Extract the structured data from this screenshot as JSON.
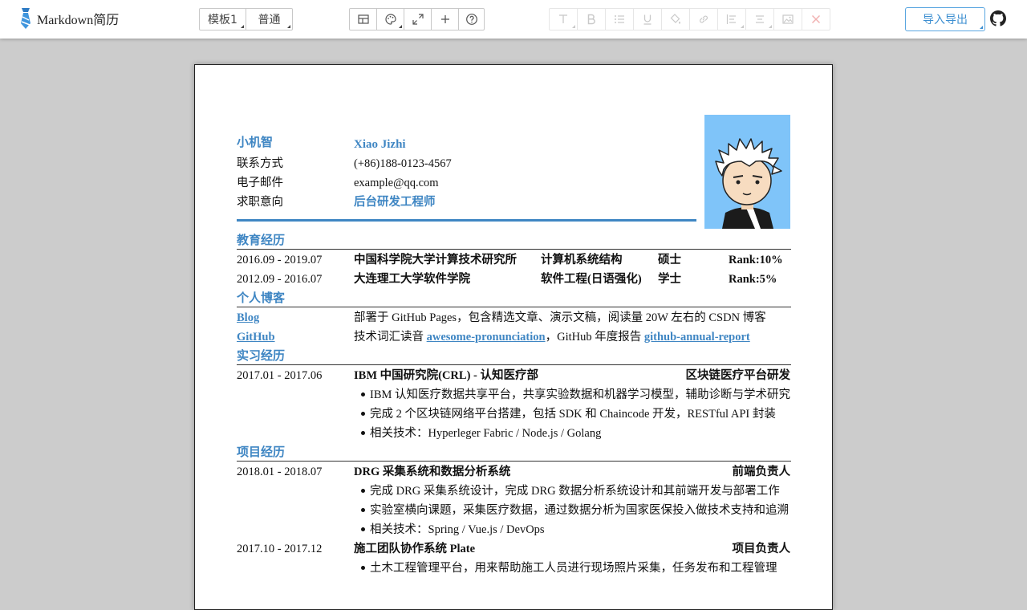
{
  "app": {
    "title": "Markdown简历",
    "template_label": "模板1",
    "style_label": "普通",
    "import_export_label": "导入导出"
  },
  "icons": {
    "logo": "tie-icon",
    "view": [
      "layout-icon",
      "palette-icon",
      "expand-icon",
      "plus-icon",
      "help-icon"
    ],
    "format": [
      "text-icon",
      "bold-icon",
      "list-icon",
      "underline-icon",
      "fill-color-icon",
      "link-icon",
      "align-left-icon",
      "align-center-icon",
      "image-icon",
      "close-icon"
    ],
    "github": "github-icon"
  },
  "colors": {
    "accent": "#3f86c3",
    "avatar_bg": "#7fc4f9"
  },
  "resume": {
    "name_cn": "小机智",
    "name_en": "Xiao Jizhi",
    "contact": [
      {
        "label": "联系方式",
        "value": "(+86)188-0123-4567"
      },
      {
        "label": "电子邮件",
        "value": "example@qq.com"
      },
      {
        "label": "求职意向",
        "value": "后台研发工程师"
      }
    ],
    "education": {
      "title": "教育经历",
      "rows": [
        {
          "period": "2016.09 - 2019.07",
          "school": "中国科学院大学计算技术研究所",
          "major": "计算机系统结构",
          "degree": "硕士",
          "rank": "Rank:10%"
        },
        {
          "period": "2012.09 - 2016.07",
          "school": "大连理工大学软件学院",
          "major": "软件工程(日语强化)",
          "degree": "学士",
          "rank": "Rank:5%"
        }
      ]
    },
    "blog": {
      "title": "个人博客",
      "blog_label": "Blog",
      "blog_desc": "部署于 GitHub Pages，包含精选文章、演示文稿，阅读量 20W 左右的 CSDN 博客",
      "github_label": "GitHub",
      "github_prefix": "技术词汇读音 ",
      "github_link1": "awesome-pronunciation",
      "github_mid": "，GitHub 年度报告 ",
      "github_link2": "github-annual-report"
    },
    "internship": {
      "title": "实习经历",
      "period": "2017.01 - 2017.06",
      "org": "IBM 中国研究院(CRL) - 认知医疗部",
      "role": "区块链医疗平台研发",
      "bullets": [
        "IBM 认知医疗数据共享平台，共享实验数据和机器学习模型，辅助诊断与学术研究",
        "完成 2 个区块链网络平台搭建，包括 SDK 和 Chaincode 开发，RESTful API 封装",
        "相关技术：Hyperleger Fabric / Node.js / Golang"
      ]
    },
    "projects": {
      "title": "项目经历",
      "items": [
        {
          "period": "2018.01 - 2018.07",
          "name": "DRG 采集系统和数据分析系统",
          "role": "前端负责人",
          "bullets": [
            "完成 DRG 采集系统设计，完成 DRG 数据分析系统设计和其前端开发与部署工作",
            "实验室横向课题，采集医疗数据，通过数据分析为国家医保投入做技术支持和追溯",
            "相关技术：Spring / Vue.js / DevOps"
          ]
        },
        {
          "period": "2017.10 - 2017.12",
          "name": "施工团队协作系统 Plate",
          "role": "项目负责人",
          "bullets": [
            "土木工程管理平台，用来帮助施工人员进行现场照片采集，任务发布和工程管理"
          ]
        }
      ]
    }
  }
}
